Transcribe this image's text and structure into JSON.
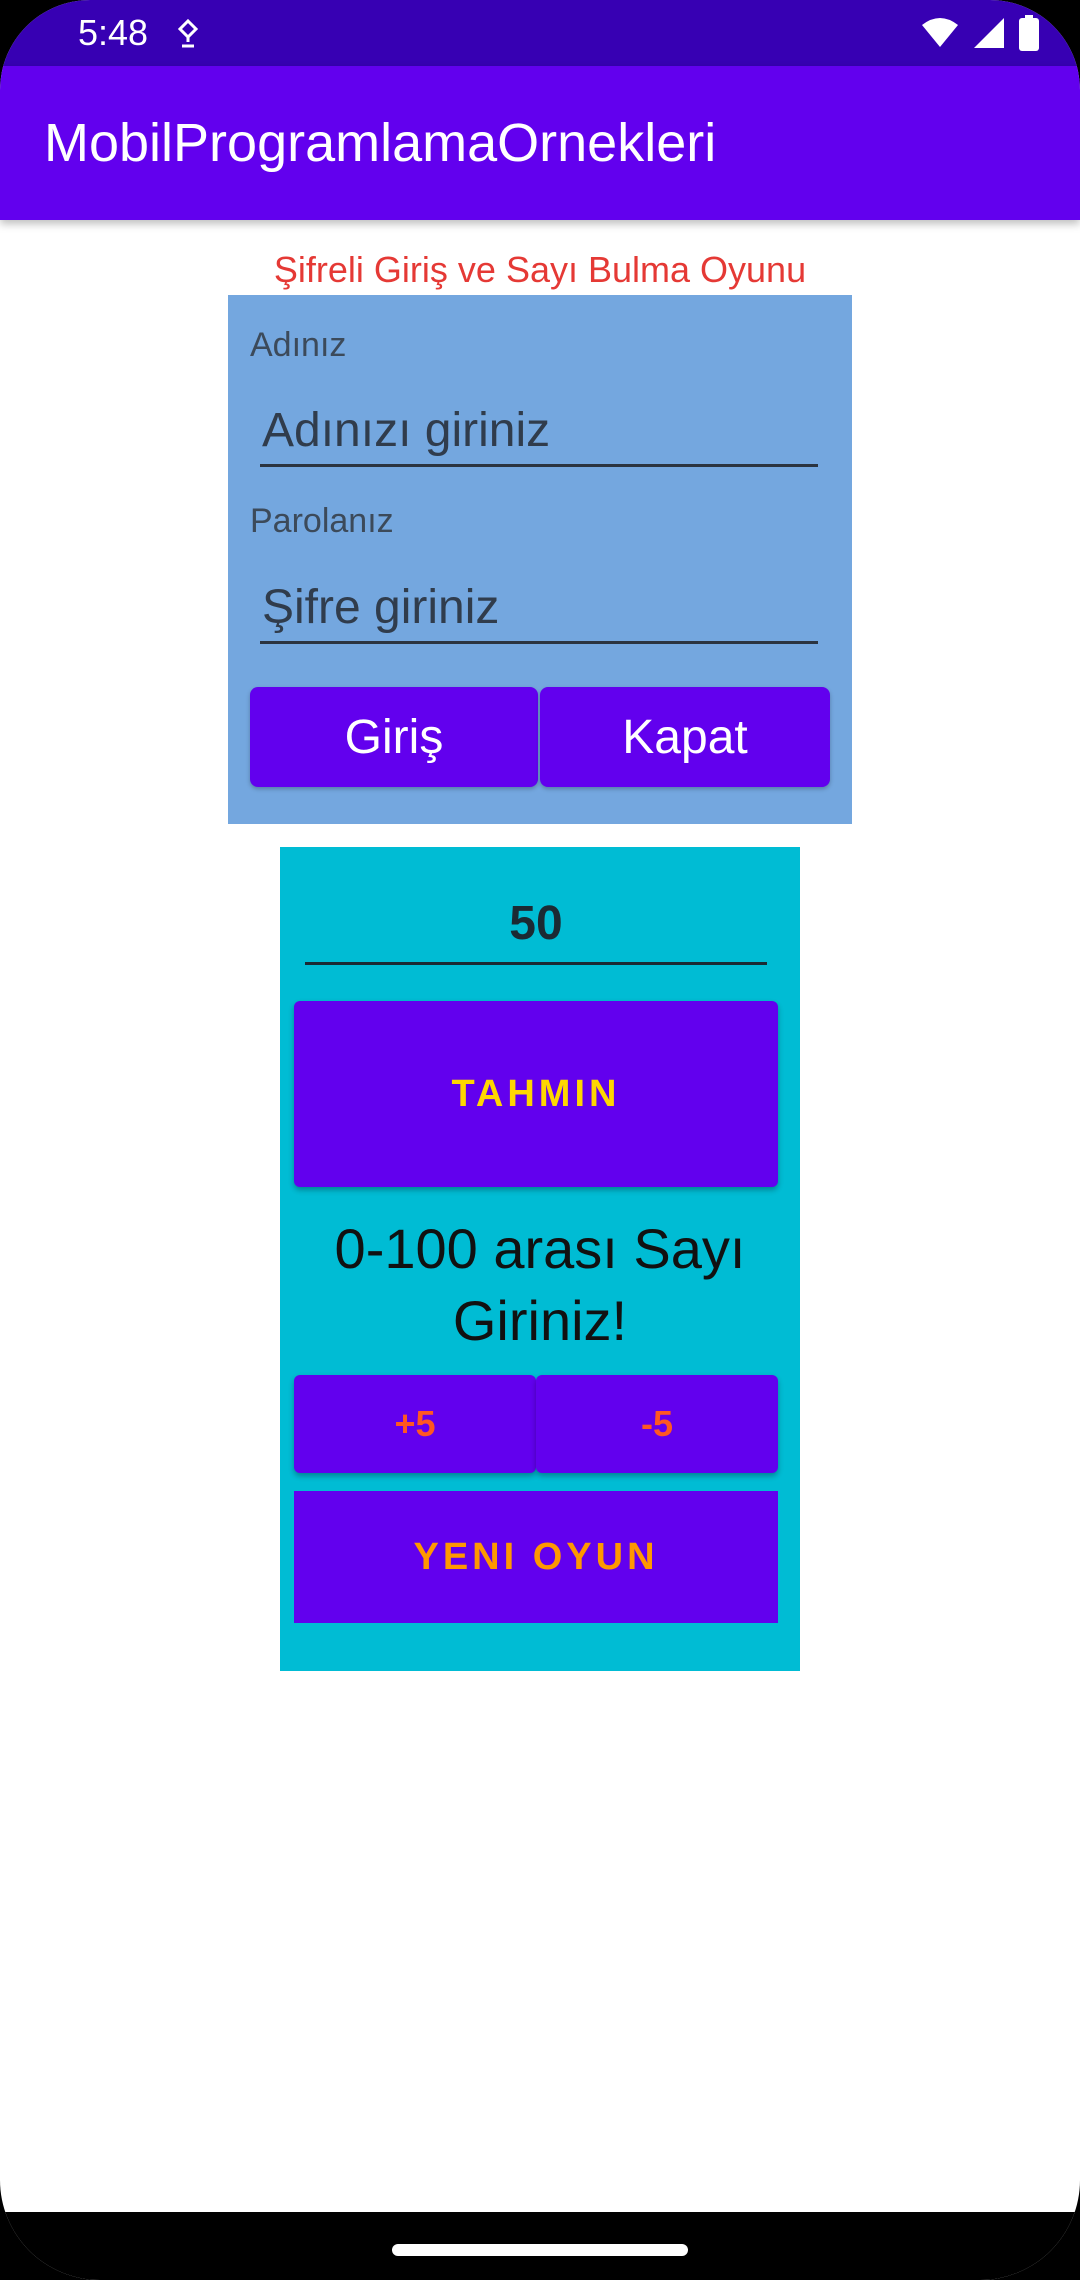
{
  "status_bar": {
    "time": "5:48",
    "icons": [
      "location-icon",
      "wifi-icon",
      "signal-icon",
      "battery-icon"
    ]
  },
  "app_bar": {
    "title": "MobilProgramlamaOrnekleri",
    "color": "#6200ee"
  },
  "heading": "Şifreli Giriş ve Sayı Bulma Oyunu",
  "login": {
    "name_label": "Adınız",
    "name_placeholder": "Adınızı giriniz",
    "password_label": "Parolanız",
    "password_placeholder": "Şifre giriniz",
    "login_button": "Giriş",
    "close_button": "Kapat",
    "panel_color": "#74a7df"
  },
  "game": {
    "guess_value": "50",
    "guess_button": "TAHMIN",
    "message": "0-100 arası Sayı Giriniz!",
    "plus_button": "+5",
    "minus_button": "-5",
    "new_game_button": "YENI OYUN",
    "panel_color": "#00bcd4"
  }
}
